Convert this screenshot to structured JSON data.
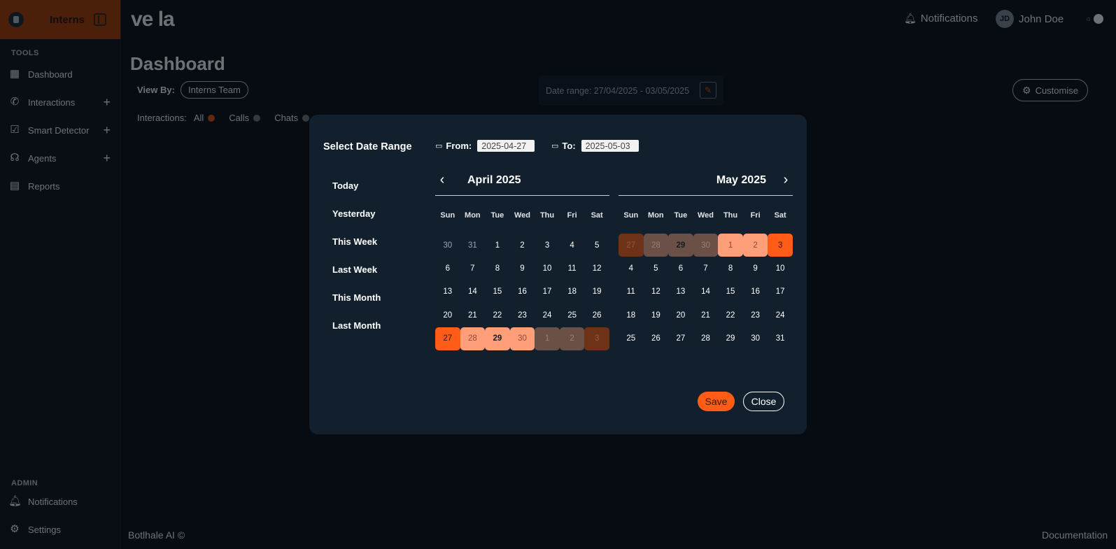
{
  "colors": {
    "accent": "#ff5c17",
    "accent_light": "#ff9f7a",
    "background": "#0c1620",
    "modal": "#12202d"
  },
  "sidebar": {
    "team": "Interns",
    "tools_label": "TOOLS",
    "items": [
      {
        "label": "Dashboard",
        "icon": "dashboard-icon"
      },
      {
        "label": "Interactions",
        "icon": "phone-icon"
      },
      {
        "label": "Smart Detector",
        "icon": "detector-icon"
      },
      {
        "label": "Agents",
        "icon": "headset-icon"
      },
      {
        "label": "Reports",
        "icon": "report-icon"
      }
    ],
    "admin_label": "ADMIN",
    "admin_items": [
      {
        "label": "Notifications",
        "icon": "bell-icon"
      },
      {
        "label": "Settings",
        "icon": "gear-icon"
      }
    ]
  },
  "header": {
    "brand": "ve la",
    "notifications": "Notifications",
    "user_initials": "JD",
    "user_name": "John Doe"
  },
  "dashboard": {
    "title": "Dashboard",
    "view_by_label": "View By:",
    "view_by_value": "Interns Team",
    "interactions_label": "Interactions:",
    "filters": [
      "All",
      "Calls",
      "Chats"
    ],
    "date_range": "Date range: 27/04/2025 - 03/05/2025",
    "customise": "Customise"
  },
  "footer": {
    "left": "Botlhale AI ©",
    "right": "Documentation"
  },
  "modal": {
    "title": "Select Date Range",
    "from_label": "From:",
    "from_value": "2025-04-27",
    "to_label": "To:",
    "to_value": "2025-05-03",
    "presets": [
      "Today",
      "Yesterday",
      "This Week",
      "Last Week",
      "This Month",
      "Last Month"
    ],
    "weekdays": [
      "Sun",
      "Mon",
      "Tue",
      "Wed",
      "Thu",
      "Fri",
      "Sat"
    ],
    "left_month": {
      "title": "April 2025",
      "days": [
        {
          "d": "30",
          "s": "muted"
        },
        {
          "d": "31",
          "s": "muted"
        },
        {
          "d": "1"
        },
        {
          "d": "2"
        },
        {
          "d": "3"
        },
        {
          "d": "4"
        },
        {
          "d": "5"
        },
        {
          "d": "6"
        },
        {
          "d": "7"
        },
        {
          "d": "8"
        },
        {
          "d": "9"
        },
        {
          "d": "10"
        },
        {
          "d": "11"
        },
        {
          "d": "12"
        },
        {
          "d": "13"
        },
        {
          "d": "14"
        },
        {
          "d": "15"
        },
        {
          "d": "16"
        },
        {
          "d": "17"
        },
        {
          "d": "18"
        },
        {
          "d": "19"
        },
        {
          "d": "20"
        },
        {
          "d": "21"
        },
        {
          "d": "22"
        },
        {
          "d": "23"
        },
        {
          "d": "24"
        },
        {
          "d": "25"
        },
        {
          "d": "26"
        },
        {
          "d": "27",
          "s": "sel-start"
        },
        {
          "d": "28",
          "s": "in-range"
        },
        {
          "d": "29",
          "s": "in-range bold"
        },
        {
          "d": "30",
          "s": "in-range"
        },
        {
          "d": "1",
          "s": "dim-range"
        },
        {
          "d": "2",
          "s": "dim-range"
        },
        {
          "d": "3",
          "s": "dim-edge"
        }
      ]
    },
    "right_month": {
      "title": "May 2025",
      "days": [
        {
          "d": "27",
          "s": "dim-edge"
        },
        {
          "d": "28",
          "s": "dim-range"
        },
        {
          "d": "29",
          "s": "dim-range dim-bold"
        },
        {
          "d": "30",
          "s": "dim-range"
        },
        {
          "d": "1",
          "s": "in-range"
        },
        {
          "d": "2",
          "s": "in-range"
        },
        {
          "d": "3",
          "s": "sel-end"
        },
        {
          "d": "4"
        },
        {
          "d": "5"
        },
        {
          "d": "6"
        },
        {
          "d": "7"
        },
        {
          "d": "8"
        },
        {
          "d": "9"
        },
        {
          "d": "10"
        },
        {
          "d": "11"
        },
        {
          "d": "12"
        },
        {
          "d": "13"
        },
        {
          "d": "14"
        },
        {
          "d": "15"
        },
        {
          "d": "16"
        },
        {
          "d": "17"
        },
        {
          "d": "18"
        },
        {
          "d": "19"
        },
        {
          "d": "20"
        },
        {
          "d": "21"
        },
        {
          "d": "22"
        },
        {
          "d": "23"
        },
        {
          "d": "24"
        },
        {
          "d": "25"
        },
        {
          "d": "26"
        },
        {
          "d": "27"
        },
        {
          "d": "28"
        },
        {
          "d": "29"
        },
        {
          "d": "30"
        },
        {
          "d": "31"
        }
      ]
    },
    "save": "Save",
    "close": "Close"
  }
}
